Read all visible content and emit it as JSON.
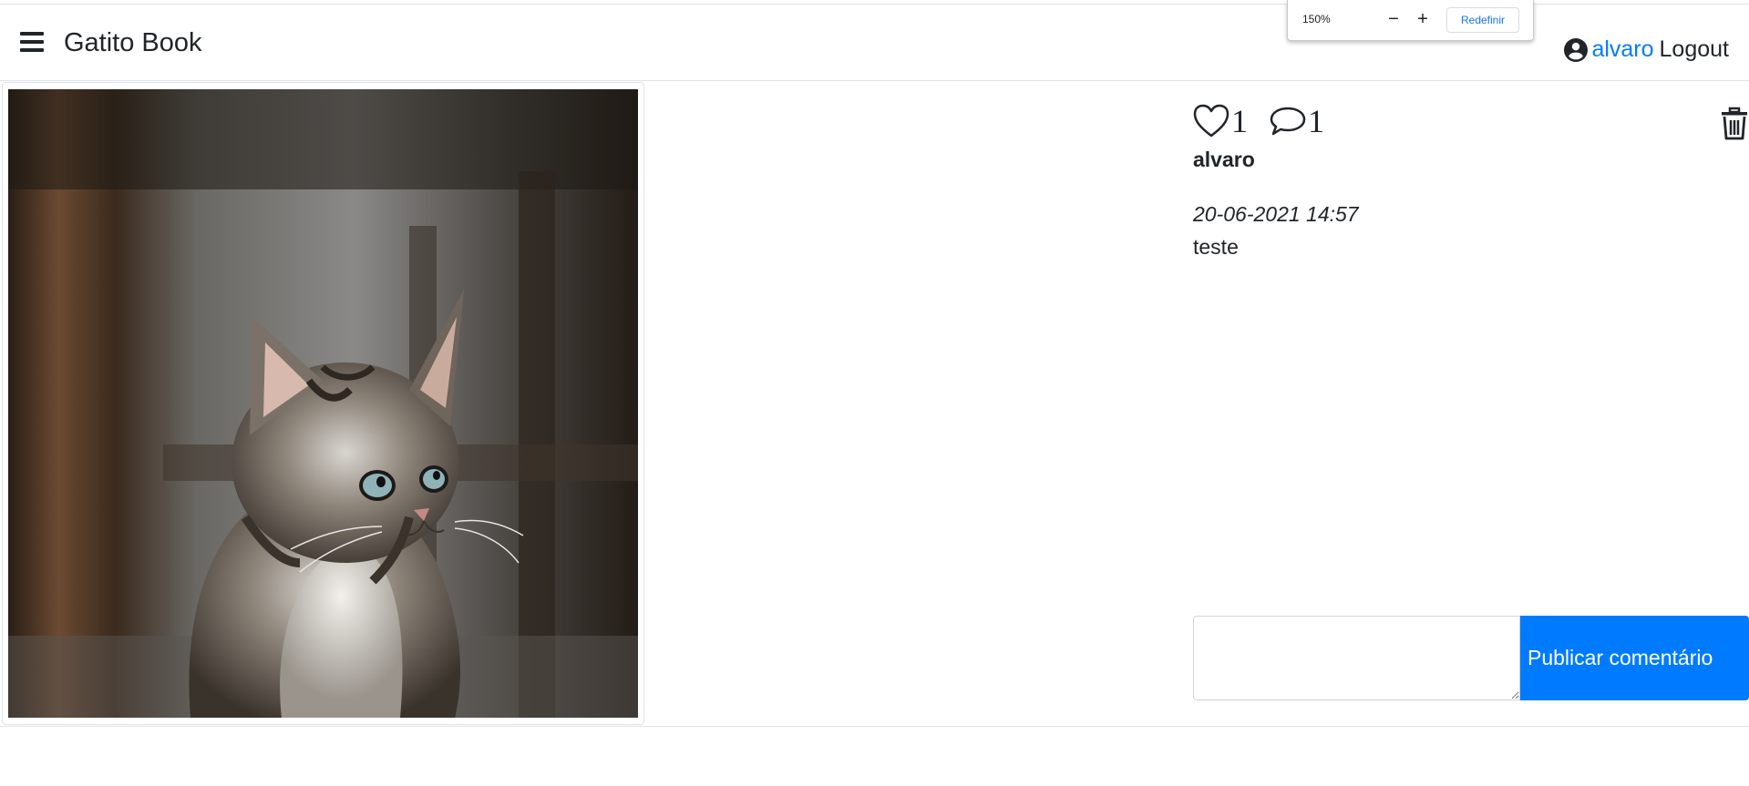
{
  "browser": {
    "zoom_popup": {
      "level": "150%",
      "minus": "−",
      "plus": "+",
      "reset_label": "Redefinir"
    }
  },
  "header": {
    "brand": "Gatito Book",
    "menu_icon": "hamburger-menu-icon",
    "user_icon": "user-circle-icon",
    "username": "alvaro",
    "logout_label": "Logout"
  },
  "post": {
    "image_alt": "Kitten looking up",
    "likes": "1",
    "comments": "1",
    "like_icon": "heart-outline-icon",
    "comment_icon": "chat-bubble-icon",
    "delete_icon": "trash-icon",
    "author": "alvaro",
    "date": "20-06-2021 14:57",
    "description": "teste"
  },
  "comment_form": {
    "input_value": "",
    "submit_label": "Publicar comentário"
  },
  "colors": {
    "primary": "#007bff",
    "text": "#212529",
    "border": "#dee2e6"
  }
}
